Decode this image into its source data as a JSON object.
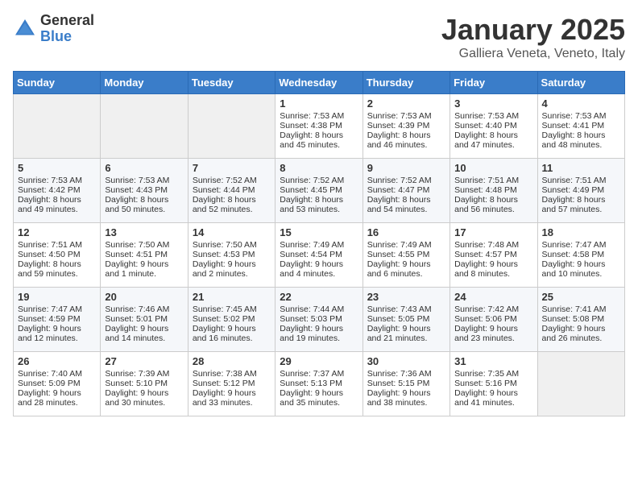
{
  "header": {
    "logo_general": "General",
    "logo_blue": "Blue",
    "month_title": "January 2025",
    "subtitle": "Galliera Veneta, Veneto, Italy"
  },
  "days_of_week": [
    "Sunday",
    "Monday",
    "Tuesday",
    "Wednesday",
    "Thursday",
    "Friday",
    "Saturday"
  ],
  "weeks": [
    [
      {
        "day": "",
        "sunrise": "",
        "sunset": "",
        "daylight": "",
        "empty": true
      },
      {
        "day": "",
        "sunrise": "",
        "sunset": "",
        "daylight": "",
        "empty": true
      },
      {
        "day": "",
        "sunrise": "",
        "sunset": "",
        "daylight": "",
        "empty": true
      },
      {
        "day": "1",
        "sunrise": "Sunrise: 7:53 AM",
        "sunset": "Sunset: 4:38 PM",
        "daylight": "Daylight: 8 hours and 45 minutes."
      },
      {
        "day": "2",
        "sunrise": "Sunrise: 7:53 AM",
        "sunset": "Sunset: 4:39 PM",
        "daylight": "Daylight: 8 hours and 46 minutes."
      },
      {
        "day": "3",
        "sunrise": "Sunrise: 7:53 AM",
        "sunset": "Sunset: 4:40 PM",
        "daylight": "Daylight: 8 hours and 47 minutes."
      },
      {
        "day": "4",
        "sunrise": "Sunrise: 7:53 AM",
        "sunset": "Sunset: 4:41 PM",
        "daylight": "Daylight: 8 hours and 48 minutes."
      }
    ],
    [
      {
        "day": "5",
        "sunrise": "Sunrise: 7:53 AM",
        "sunset": "Sunset: 4:42 PM",
        "daylight": "Daylight: 8 hours and 49 minutes."
      },
      {
        "day": "6",
        "sunrise": "Sunrise: 7:53 AM",
        "sunset": "Sunset: 4:43 PM",
        "daylight": "Daylight: 8 hours and 50 minutes."
      },
      {
        "day": "7",
        "sunrise": "Sunrise: 7:52 AM",
        "sunset": "Sunset: 4:44 PM",
        "daylight": "Daylight: 8 hours and 52 minutes."
      },
      {
        "day": "8",
        "sunrise": "Sunrise: 7:52 AM",
        "sunset": "Sunset: 4:45 PM",
        "daylight": "Daylight: 8 hours and 53 minutes."
      },
      {
        "day": "9",
        "sunrise": "Sunrise: 7:52 AM",
        "sunset": "Sunset: 4:47 PM",
        "daylight": "Daylight: 8 hours and 54 minutes."
      },
      {
        "day": "10",
        "sunrise": "Sunrise: 7:51 AM",
        "sunset": "Sunset: 4:48 PM",
        "daylight": "Daylight: 8 hours and 56 minutes."
      },
      {
        "day": "11",
        "sunrise": "Sunrise: 7:51 AM",
        "sunset": "Sunset: 4:49 PM",
        "daylight": "Daylight: 8 hours and 57 minutes."
      }
    ],
    [
      {
        "day": "12",
        "sunrise": "Sunrise: 7:51 AM",
        "sunset": "Sunset: 4:50 PM",
        "daylight": "Daylight: 8 hours and 59 minutes."
      },
      {
        "day": "13",
        "sunrise": "Sunrise: 7:50 AM",
        "sunset": "Sunset: 4:51 PM",
        "daylight": "Daylight: 9 hours and 1 minute."
      },
      {
        "day": "14",
        "sunrise": "Sunrise: 7:50 AM",
        "sunset": "Sunset: 4:53 PM",
        "daylight": "Daylight: 9 hours and 2 minutes."
      },
      {
        "day": "15",
        "sunrise": "Sunrise: 7:49 AM",
        "sunset": "Sunset: 4:54 PM",
        "daylight": "Daylight: 9 hours and 4 minutes."
      },
      {
        "day": "16",
        "sunrise": "Sunrise: 7:49 AM",
        "sunset": "Sunset: 4:55 PM",
        "daylight": "Daylight: 9 hours and 6 minutes."
      },
      {
        "day": "17",
        "sunrise": "Sunrise: 7:48 AM",
        "sunset": "Sunset: 4:57 PM",
        "daylight": "Daylight: 9 hours and 8 minutes."
      },
      {
        "day": "18",
        "sunrise": "Sunrise: 7:47 AM",
        "sunset": "Sunset: 4:58 PM",
        "daylight": "Daylight: 9 hours and 10 minutes."
      }
    ],
    [
      {
        "day": "19",
        "sunrise": "Sunrise: 7:47 AM",
        "sunset": "Sunset: 4:59 PM",
        "daylight": "Daylight: 9 hours and 12 minutes."
      },
      {
        "day": "20",
        "sunrise": "Sunrise: 7:46 AM",
        "sunset": "Sunset: 5:01 PM",
        "daylight": "Daylight: 9 hours and 14 minutes."
      },
      {
        "day": "21",
        "sunrise": "Sunrise: 7:45 AM",
        "sunset": "Sunset: 5:02 PM",
        "daylight": "Daylight: 9 hours and 16 minutes."
      },
      {
        "day": "22",
        "sunrise": "Sunrise: 7:44 AM",
        "sunset": "Sunset: 5:03 PM",
        "daylight": "Daylight: 9 hours and 19 minutes."
      },
      {
        "day": "23",
        "sunrise": "Sunrise: 7:43 AM",
        "sunset": "Sunset: 5:05 PM",
        "daylight": "Daylight: 9 hours and 21 minutes."
      },
      {
        "day": "24",
        "sunrise": "Sunrise: 7:42 AM",
        "sunset": "Sunset: 5:06 PM",
        "daylight": "Daylight: 9 hours and 23 minutes."
      },
      {
        "day": "25",
        "sunrise": "Sunrise: 7:41 AM",
        "sunset": "Sunset: 5:08 PM",
        "daylight": "Daylight: 9 hours and 26 minutes."
      }
    ],
    [
      {
        "day": "26",
        "sunrise": "Sunrise: 7:40 AM",
        "sunset": "Sunset: 5:09 PM",
        "daylight": "Daylight: 9 hours and 28 minutes."
      },
      {
        "day": "27",
        "sunrise": "Sunrise: 7:39 AM",
        "sunset": "Sunset: 5:10 PM",
        "daylight": "Daylight: 9 hours and 30 minutes."
      },
      {
        "day": "28",
        "sunrise": "Sunrise: 7:38 AM",
        "sunset": "Sunset: 5:12 PM",
        "daylight": "Daylight: 9 hours and 33 minutes."
      },
      {
        "day": "29",
        "sunrise": "Sunrise: 7:37 AM",
        "sunset": "Sunset: 5:13 PM",
        "daylight": "Daylight: 9 hours and 35 minutes."
      },
      {
        "day": "30",
        "sunrise": "Sunrise: 7:36 AM",
        "sunset": "Sunset: 5:15 PM",
        "daylight": "Daylight: 9 hours and 38 minutes."
      },
      {
        "day": "31",
        "sunrise": "Sunrise: 7:35 AM",
        "sunset": "Sunset: 5:16 PM",
        "daylight": "Daylight: 9 hours and 41 minutes."
      },
      {
        "day": "",
        "sunrise": "",
        "sunset": "",
        "daylight": "",
        "empty": true
      }
    ]
  ]
}
